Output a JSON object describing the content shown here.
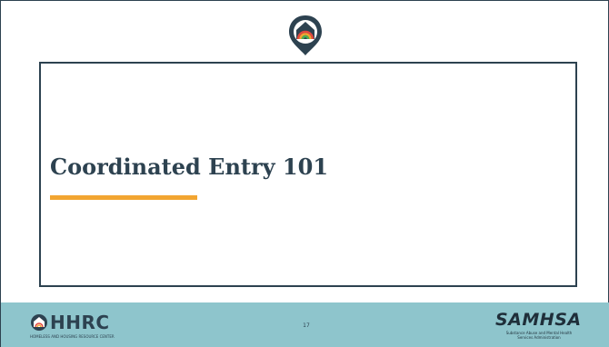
{
  "slide": {
    "title": "Coordinated Entry 101",
    "page_number": "17"
  },
  "footer": {
    "left_logo": {
      "text": "HHRC",
      "subtitle": "HOMELESS AND HOUSING RESOURCE CENTER"
    },
    "right_logo": {
      "text": "SAMHSA",
      "subtitle_line1": "Substance Abuse and Mental Health",
      "subtitle_line2": "Services Administration"
    }
  },
  "colors": {
    "navy": "#2d4250",
    "accent_orange": "#f2a531",
    "footer_teal": "#8ec5cc"
  },
  "icons": {
    "top": "location-pin-house-rainbow-icon",
    "hhrc_mark": "house-rainbow-icon"
  }
}
